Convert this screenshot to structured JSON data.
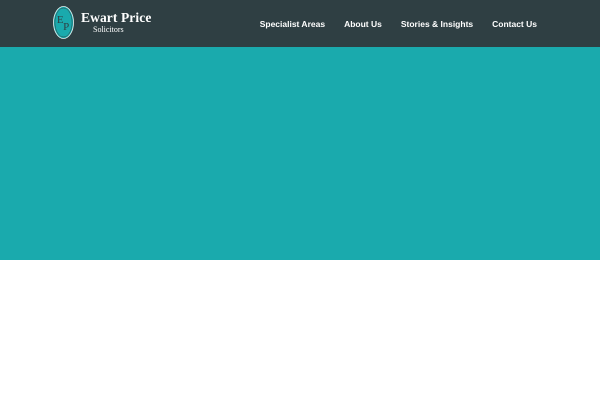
{
  "brand": {
    "name": "Ewart Price",
    "subtitle": "Solicitors",
    "monogram": "EP",
    "accent_color": "#1aaaad",
    "header_color": "#2f3f43"
  },
  "nav": {
    "items": [
      {
        "label": "Specialist Areas"
      },
      {
        "label": "About Us"
      },
      {
        "label": "Stories & Insights"
      },
      {
        "label": "Contact Us"
      }
    ]
  },
  "hero": {
    "background_color": "#1aaaad"
  },
  "icons": {
    "logo": "ep-monogram-oval-icon"
  }
}
